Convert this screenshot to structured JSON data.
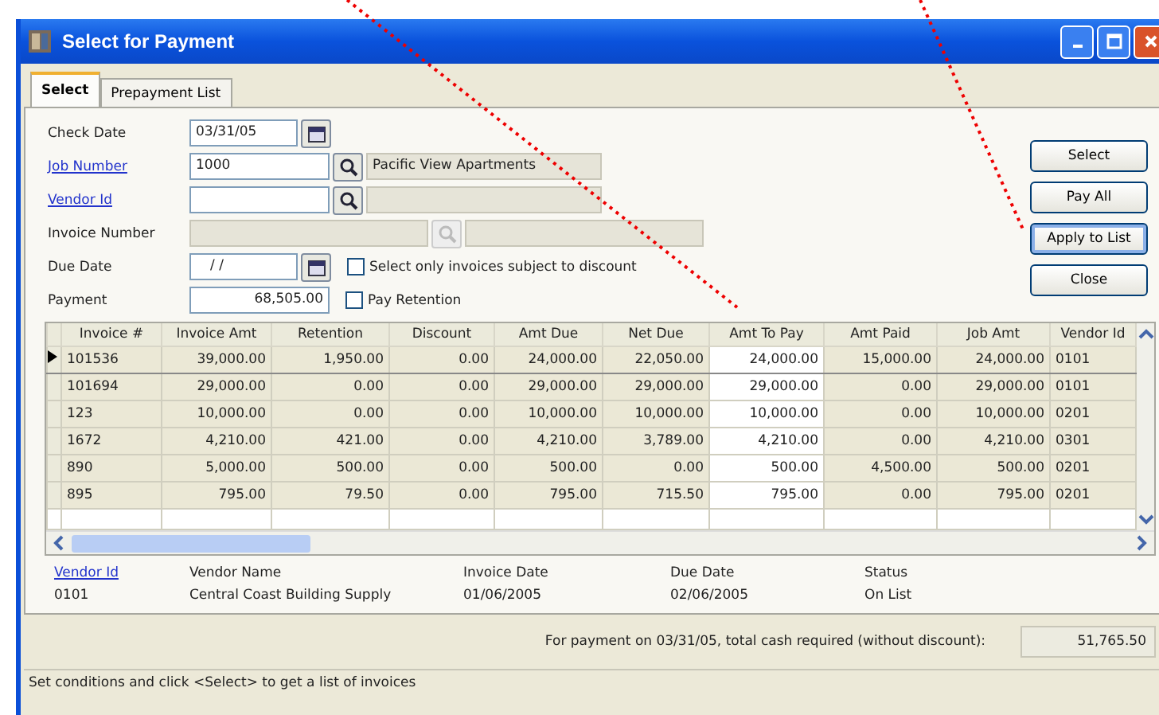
{
  "window": {
    "title": "Select for Payment"
  },
  "tabs": [
    {
      "label": "Select",
      "selected": true
    },
    {
      "label": "Prepayment List",
      "selected": false
    }
  ],
  "form": {
    "check_date": {
      "label": "Check Date",
      "value": "03/31/05"
    },
    "job_number": {
      "label": "Job Number",
      "value": "1000",
      "description": "Pacific View Apartments"
    },
    "vendor_id": {
      "label": "Vendor Id"
    },
    "invoice_number": {
      "label": "Invoice Number",
      "disabled": true
    },
    "due_date": {
      "label": "Due Date",
      "value": "/ /"
    },
    "discount_only": {
      "label": "Select only invoices subject to discount",
      "checked": false
    },
    "payment": {
      "label": "Payment",
      "value": "68,505.00"
    },
    "pay_retention": {
      "label": "Pay Retention",
      "checked": false
    }
  },
  "buttons": [
    {
      "label": "Select",
      "focused": false
    },
    {
      "label": "Pay All",
      "focused": false
    },
    {
      "label": "Apply to List",
      "focused": true
    },
    {
      "label": "Close",
      "focused": false
    }
  ],
  "grid": {
    "columns": [
      {
        "label": "Invoice #",
        "editable": false
      },
      {
        "label": "Invoice Amt",
        "editable": false
      },
      {
        "label": "Retention",
        "editable": false
      },
      {
        "label": "Discount",
        "editable": false
      },
      {
        "label": "Amt Due",
        "editable": false
      },
      {
        "label": "Net Due",
        "editable": false
      },
      {
        "label": "Amt To Pay",
        "editable": true
      },
      {
        "label": "Amt Paid",
        "editable": false
      },
      {
        "label": "Job Amt",
        "editable": false
      },
      {
        "label": "Vendor Id",
        "editable": false
      }
    ],
    "rows": [
      {
        "selected": true,
        "cells": [
          "101536",
          "39,000.00",
          "1,950.00",
          "0.00",
          "24,000.00",
          "22,050.00",
          "24,000.00",
          "15,000.00",
          "24,000.00",
          "0101"
        ]
      },
      {
        "selected": false,
        "cells": [
          "101694",
          "29,000.00",
          "0.00",
          "0.00",
          "29,000.00",
          "29,000.00",
          "29,000.00",
          "0.00",
          "29,000.00",
          "0101"
        ]
      },
      {
        "selected": false,
        "cells": [
          "123",
          "10,000.00",
          "0.00",
          "0.00",
          "10,000.00",
          "10,000.00",
          "10,000.00",
          "0.00",
          "10,000.00",
          "0201"
        ]
      },
      {
        "selected": false,
        "cells": [
          "1672",
          "4,210.00",
          "421.00",
          "0.00",
          "4,210.00",
          "3,789.00",
          "4,210.00",
          "0.00",
          "4,210.00",
          "0301"
        ]
      },
      {
        "selected": false,
        "cells": [
          "890",
          "5,000.00",
          "500.00",
          "0.00",
          "500.00",
          "0.00",
          "500.00",
          "4,500.00",
          "500.00",
          "0201"
        ]
      },
      {
        "selected": false,
        "cells": [
          "895",
          "795.00",
          "79.50",
          "0.00",
          "795.00",
          "715.50",
          "795.00",
          "0.00",
          "795.00",
          "0201"
        ]
      }
    ]
  },
  "details": [
    {
      "label": "Vendor Id",
      "link": true,
      "value": "0101"
    },
    {
      "label": "Vendor Name",
      "link": false,
      "value": "Central Coast Building Supply"
    },
    {
      "label": "Invoice Date",
      "link": false,
      "value": "01/06/2005"
    },
    {
      "label": "Due Date",
      "link": false,
      "value": "02/06/2005"
    },
    {
      "label": "Status",
      "link": false,
      "value": "On List"
    }
  ],
  "total": {
    "label": "For payment on 03/31/05, total cash required (without discount):",
    "value": "51,765.50"
  },
  "status_bar": "Set conditions and click <Select> to get a list of invoices"
}
